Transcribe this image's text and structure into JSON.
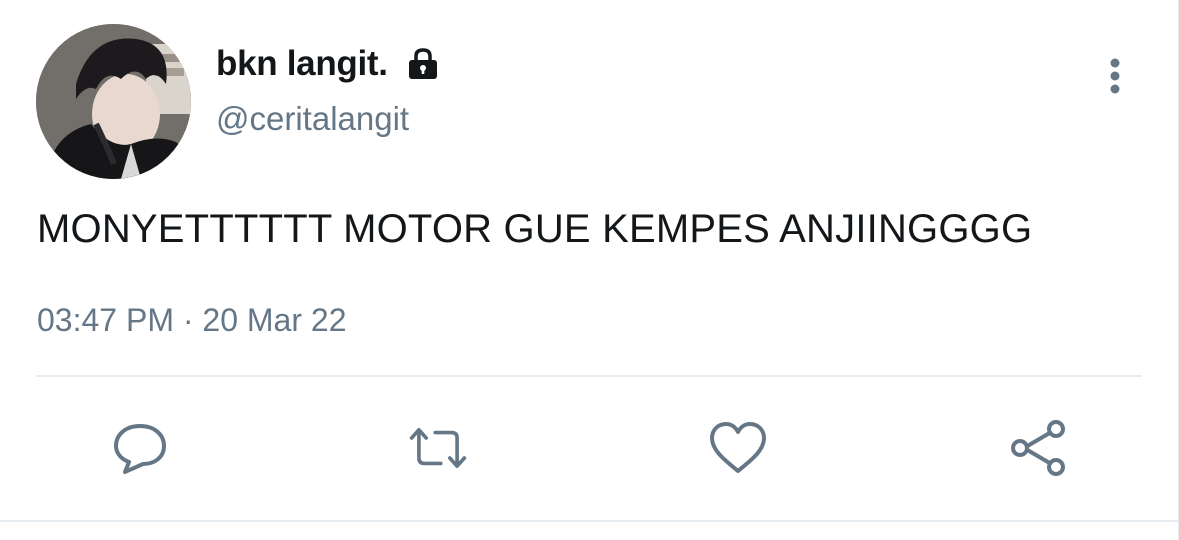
{
  "tweet": {
    "display_name": "bkn langit.",
    "handle": "@ceritalangit",
    "protected": true,
    "text": "MONYETTTTTT MOTOR GUE KEMPES ANJIINGGGG",
    "timestamp": "03:47 PM · 20 Mar 22"
  },
  "icons": {
    "lock": "lock-icon",
    "more": "more-vertical-icon",
    "reply": "reply-icon",
    "retweet": "retweet-icon",
    "like": "heart-icon",
    "share": "share-icon"
  },
  "colors": {
    "primary_text": "#14171a",
    "secondary_text": "#657786",
    "divider": "#e6ecf0"
  }
}
